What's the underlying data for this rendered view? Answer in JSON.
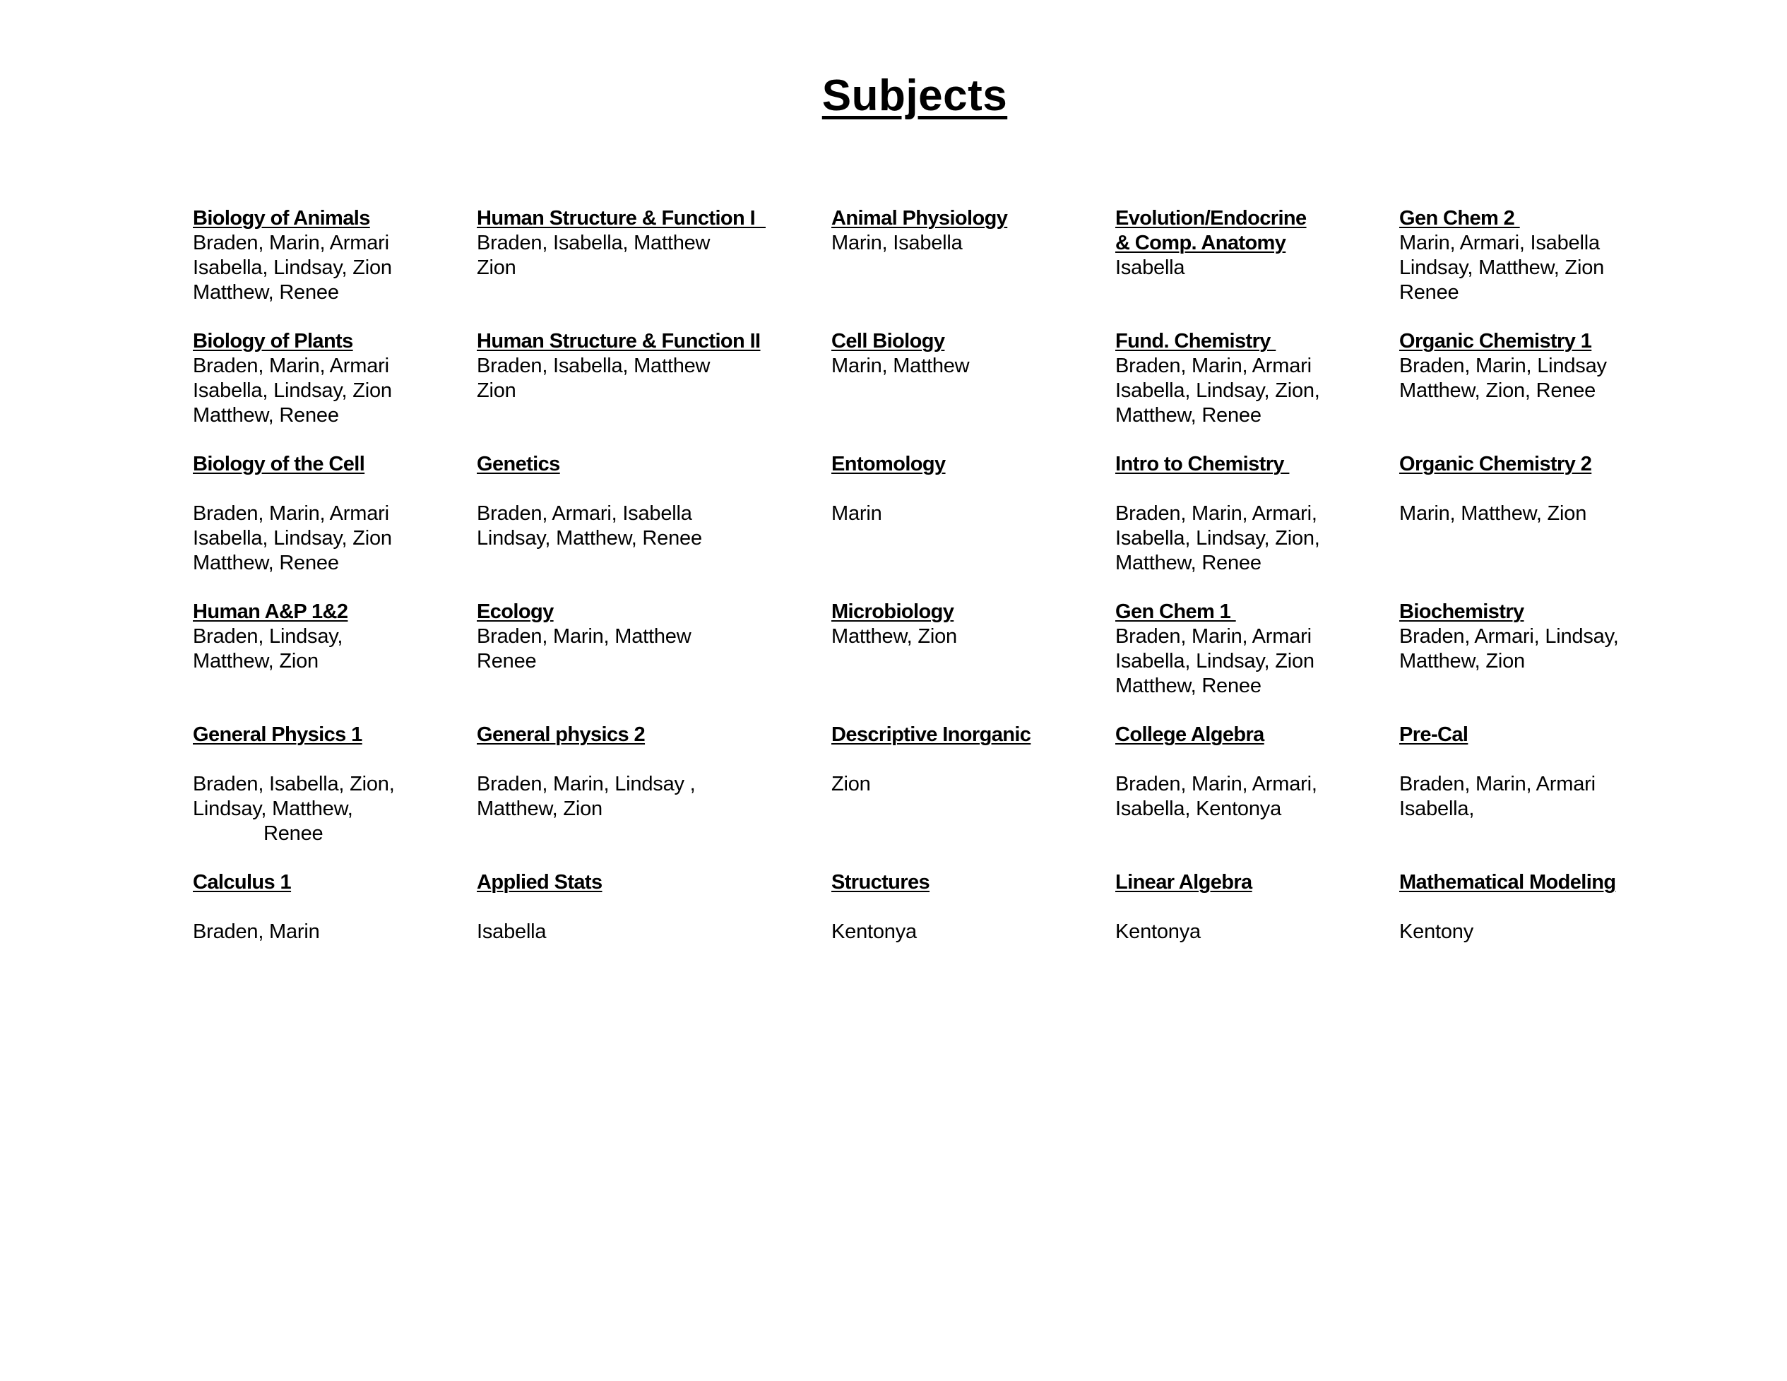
{
  "page": {
    "title": "Subjects"
  },
  "subjects": [
    [
      {
        "heading": "Biology of Animals",
        "names": [
          "Braden, Marin, Armari",
          "Isabella, Lindsay, Zion",
          "Matthew, Renee"
        ]
      },
      {
        "heading": "Human Structure & Function I  ",
        "names": [
          "Braden, Isabella, Matthew",
          "Zion"
        ]
      },
      {
        "heading": "Animal Physiology",
        "names": [
          "Marin, Isabella"
        ]
      },
      {
        "heading": "Evolution/Endocrine\n& Comp. Anatomy",
        "names": [
          "Isabella"
        ]
      },
      {
        "heading": "Gen Chem 2 ",
        "names": [
          "Marin, Armari, Isabella",
          "Lindsay, Matthew, Zion",
          "Renee"
        ]
      }
    ],
    [
      {
        "heading": "Biology of Plants",
        "names": [
          "Braden, Marin, Armari",
          "Isabella, Lindsay, Zion",
          "Matthew, Renee"
        ]
      },
      {
        "heading": "Human Structure & Function II",
        "names": [
          "Braden, Isabella, Matthew",
          "Zion"
        ]
      },
      {
        "heading": "Cell Biology",
        "names": [
          "Marin, Matthew"
        ]
      },
      {
        "heading": "Fund. Chemistry ",
        "names": [
          "Braden, Marin, Armari",
          "Isabella, Lindsay, Zion,",
          "Matthew, Renee"
        ]
      },
      {
        "heading": "Organic Chemistry 1",
        "names": [
          "Braden, Marin, Lindsay",
          "Matthew, Zion, Renee"
        ]
      }
    ],
    [
      {
        "heading": "Biology of the Cell",
        "names": [
          "Braden, Marin, Armari",
          "Isabella, Lindsay, Zion",
          "Matthew, Renee"
        ]
      },
      {
        "heading": "Genetics",
        "names": [
          "Braden, Armari, Isabella",
          "Lindsay, Matthew, Renee"
        ]
      },
      {
        "heading": "Entomology",
        "names": [
          "Marin"
        ]
      },
      {
        "heading": "Intro to Chemistry ",
        "names": [
          "Braden, Marin, Armari,",
          "Isabella, Lindsay, Zion,",
          "Matthew, Renee"
        ]
      },
      {
        "heading": "Organic Chemistry 2",
        "names": [
          "Marin, Matthew, Zion"
        ]
      }
    ],
    [
      {
        "heading": "Human A&P 1&2",
        "names": [
          "Braden, Lindsay,",
          "Matthew, Zion"
        ]
      },
      {
        "heading": "Ecology",
        "names": [
          "Braden, Marin, Matthew",
          "Renee"
        ]
      },
      {
        "heading": "Microbiology",
        "names": [
          "Matthew, Zion"
        ]
      },
      {
        "heading": "Gen Chem 1 ",
        "names": [
          "Braden, Marin, Armari",
          "Isabella, Lindsay, Zion",
          "Matthew, Renee"
        ]
      },
      {
        "heading": "Biochemistry",
        "names": [
          "Braden, Armari, Lindsay,",
          "Matthew, Zion"
        ]
      }
    ],
    [
      {
        "heading": "General Physics 1",
        "names": [
          "Braden, Isabella, Zion,",
          "Lindsay, Matthew,",
          "Renee"
        ]
      },
      {
        "heading": "General physics 2",
        "names": [
          "Braden, Marin, Lindsay ,",
          "Matthew, Zion"
        ]
      },
      {
        "heading": "Descriptive Inorganic",
        "names": [
          "Zion"
        ]
      },
      {
        "heading": "College Algebra",
        "names": [
          "Braden, Marin, Armari,",
          "Isabella, Kentonya"
        ]
      },
      {
        "heading": "Pre-Cal",
        "names": [
          "Braden, Marin, Armari",
          "Isabella,"
        ]
      }
    ],
    [
      {
        "heading": "Calculus 1",
        "names": [
          "Braden, Marin"
        ]
      },
      {
        "heading": "Applied Stats",
        "names": [
          "Isabella"
        ]
      },
      {
        "heading": "Structures",
        "names": [
          "Kentonya"
        ]
      },
      {
        "heading": "Linear Algebra",
        "names": [
          "Kentonya"
        ]
      },
      {
        "heading": "Mathematical Modeling",
        "names": [
          "Kentony"
        ]
      }
    ]
  ]
}
